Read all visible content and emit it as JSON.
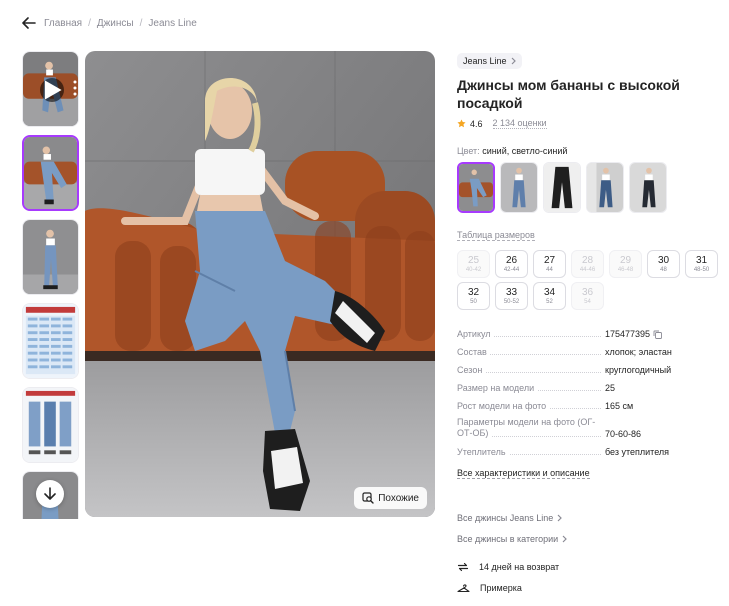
{
  "breadcrumb": [
    "Главная",
    "Джинсы",
    "Jeans Line"
  ],
  "main_photo": {
    "similar_label": "Похожие"
  },
  "product": {
    "brand": "Jeans Line",
    "title": "Джинсы мом бананы с высокой посадкой",
    "rating": "4.6",
    "reviews": "2 134 оценки",
    "color_label": "Цвет:",
    "color_value": "синий, светло-синий"
  },
  "size_table_label": "Таблица размеров",
  "sizes": [
    {
      "size": "25",
      "ru": "40-42",
      "available": false
    },
    {
      "size": "26",
      "ru": "42-44",
      "available": true
    },
    {
      "size": "27",
      "ru": "44",
      "available": true
    },
    {
      "size": "28",
      "ru": "44-46",
      "available": false
    },
    {
      "size": "29",
      "ru": "46-48",
      "available": false
    },
    {
      "size": "30",
      "ru": "48",
      "available": true
    },
    {
      "size": "31",
      "ru": "48-50",
      "available": true
    },
    {
      "size": "32",
      "ru": "50",
      "available": true
    },
    {
      "size": "33",
      "ru": "50-52",
      "available": true
    },
    {
      "size": "34",
      "ru": "52",
      "available": true
    },
    {
      "size": "36",
      "ru": "54",
      "available": false
    }
  ],
  "params": [
    {
      "key": "Артикул",
      "value": "175477395"
    },
    {
      "key": "Состав",
      "value": "хлопок; эластан"
    },
    {
      "key": "Сезон",
      "value": "круглогодичный"
    },
    {
      "key": "Размер на модели",
      "value": "25"
    },
    {
      "key": "Рост модели на фото",
      "value": "165 см"
    },
    {
      "key": "Параметры модели на фото (ОГ-ОТ-ОБ)",
      "value": "70-60-86"
    },
    {
      "key": "Утеплитель",
      "value": "без утеплителя"
    }
  ],
  "all_specs_label": "Все характеристики и описание",
  "links": {
    "brand_all": "Все джинсы Jeans Line",
    "category_all": "Все джинсы в категории"
  },
  "features": {
    "return": "14 дней на возврат",
    "fitting": "Примерка"
  },
  "colors": {
    "accent": "#a73afd",
    "star": "#f5a623",
    "denim": "#7a9cc4",
    "sofa": "#b0562a"
  }
}
